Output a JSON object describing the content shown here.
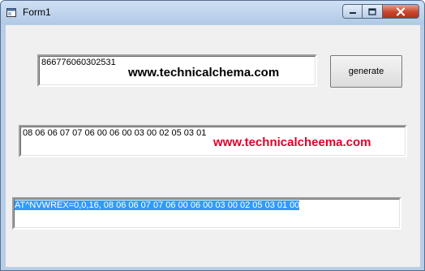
{
  "window": {
    "title": "Form1"
  },
  "imei_box": {
    "value": "866776060302531",
    "watermark": "www.technicalchema.com"
  },
  "generate_button": {
    "label": "generate"
  },
  "hex_box": {
    "value": "08 06 06 07 07 06 00 06 00 03 00 02 05 03 01",
    "watermark": "www.technicalcheema.com"
  },
  "command_box": {
    "value": "AT^NVWREX=0,0,16, 08 06 06 07 07 06 00 06 00 03 00 02 05 03 01 00",
    "selected": true
  },
  "colors": {
    "watermark_black": "#000000",
    "watermark_red": "#e0002a",
    "selection": "#3399ff"
  },
  "icons": [
    "app-icon",
    "minimize-icon",
    "maximize-icon",
    "close-icon"
  ]
}
